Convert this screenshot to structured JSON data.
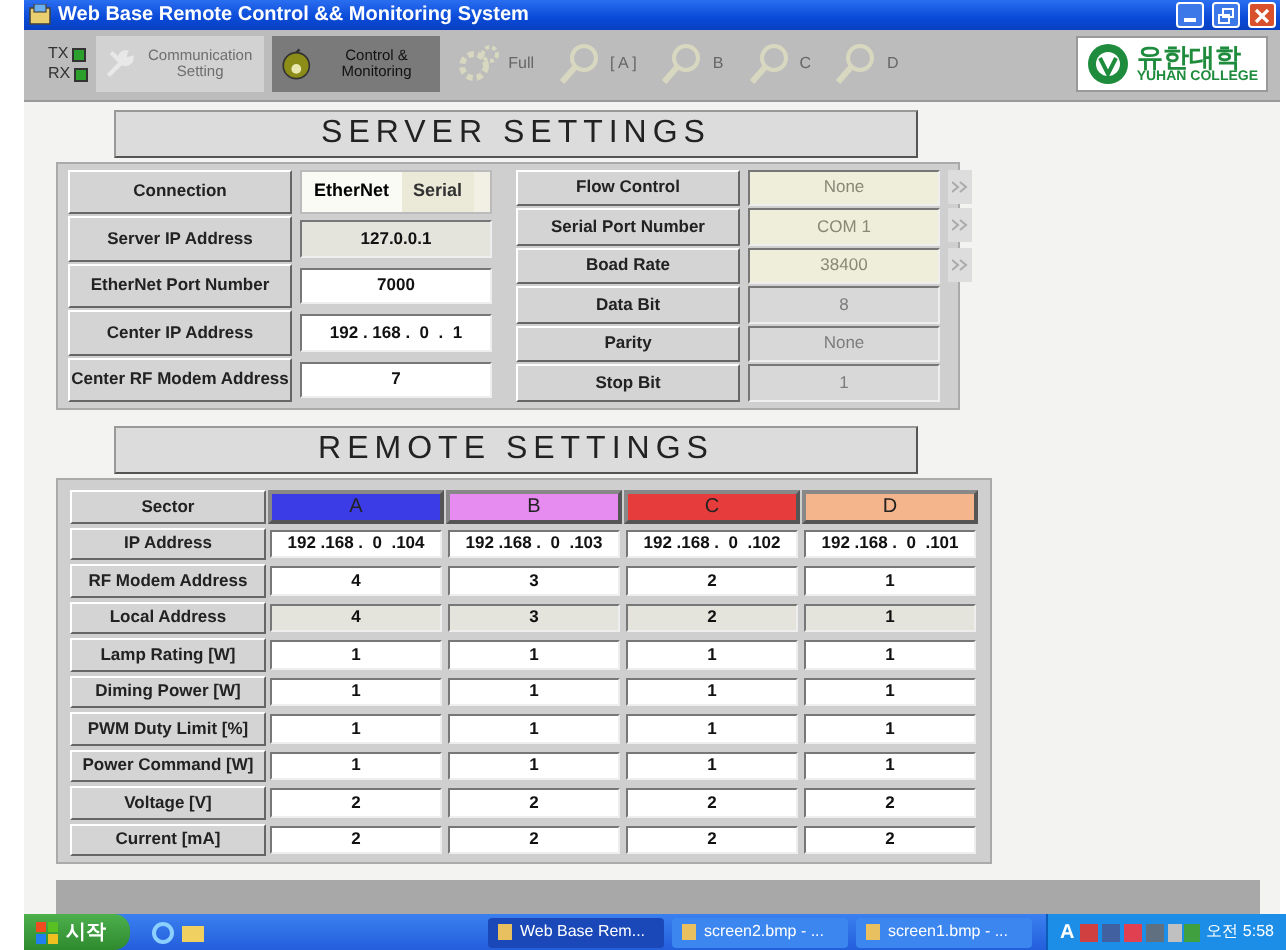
{
  "window": {
    "title": "Web Base Remote Control && Monitoring System"
  },
  "toolbar": {
    "indicators": [
      {
        "label": "TX",
        "on": true
      },
      {
        "label": "RX",
        "on": true
      }
    ],
    "modes": [
      {
        "label": "Communication Setting",
        "kind": "wrench",
        "selected": false
      },
      {
        "label": "Control & Monitoring",
        "kind": "face",
        "selected": true
      }
    ],
    "views": [
      {
        "label": "Full",
        "kind": "gear",
        "disabled": true
      },
      {
        "label": "[ A ]",
        "kind": "magnifier",
        "disabled": true
      },
      {
        "label": "B",
        "kind": "magnifier",
        "disabled": true
      },
      {
        "label": "C",
        "kind": "magnifier",
        "disabled": true
      },
      {
        "label": "D",
        "kind": "magnifier",
        "disabled": true
      }
    ],
    "logo": {
      "name": "유한대학",
      "subtitle": "YUHAN COLLEGE"
    }
  },
  "server_settings": {
    "title": "SERVER SETTINGS",
    "left": [
      {
        "label": "Connection",
        "kind": "toggle",
        "options": [
          {
            "label": "EtherNet",
            "selected": true
          },
          {
            "label": "Serial",
            "selected": false
          }
        ]
      },
      {
        "label": "Server IP Address",
        "kind": "readonly",
        "value": "127.0.0.1"
      },
      {
        "label": "EtherNet Port Number",
        "kind": "input",
        "value": "7000"
      },
      {
        "label": "Center IP Address",
        "kind": "input",
        "value": "192 . 168 .  0  .  1"
      },
      {
        "label": "Center RF Modem Address",
        "kind": "input",
        "value": "7"
      }
    ],
    "right": [
      {
        "label": "Flow Control",
        "kind": "combo",
        "value": "None",
        "disabled": true
      },
      {
        "label": "Serial Port Number",
        "kind": "combo",
        "value": "COM 1",
        "disabled": true
      },
      {
        "label": "Boad Rate",
        "kind": "combo",
        "value": "38400",
        "disabled": true
      },
      {
        "label": "Data Bit",
        "kind": "field",
        "value": "8",
        "disabled": true
      },
      {
        "label": "Parity",
        "kind": "field",
        "value": "None",
        "disabled": true
      },
      {
        "label": "Stop Bit",
        "kind": "field",
        "value": "1",
        "disabled": true
      }
    ]
  },
  "remote_settings": {
    "title": "REMOTE SETTINGS",
    "sector_label": "Sector",
    "sectors": [
      {
        "label": "A",
        "color": "#3c3ce6"
      },
      {
        "label": "B",
        "color": "#e68cf0"
      },
      {
        "label": "C",
        "color": "#e63c3c"
      },
      {
        "label": "D",
        "color": "#f4b48c"
      }
    ],
    "rows": [
      {
        "label": "IP Address",
        "kind": "input",
        "values": [
          "192 .168 .  0  .104",
          "192 .168 .  0  .103",
          "192 .168 .  0  .102",
          "192 .168 .  0  .101"
        ]
      },
      {
        "label": "RF Modem Address",
        "kind": "input",
        "values": [
          "4",
          "3",
          "2",
          "1"
        ]
      },
      {
        "label": "Local Address",
        "kind": "readonly",
        "values": [
          "4",
          "3",
          "2",
          "1"
        ]
      },
      {
        "label": "Lamp Rating [W]",
        "kind": "input",
        "values": [
          "1",
          "1",
          "1",
          "1"
        ]
      },
      {
        "label": "Diming Power [W]",
        "kind": "input",
        "values": [
          "1",
          "1",
          "1",
          "1"
        ]
      },
      {
        "label": "PWM Duty Limit [%]",
        "kind": "input",
        "values": [
          "1",
          "1",
          "1",
          "1"
        ]
      },
      {
        "label": "Power Command [W]",
        "kind": "input",
        "values": [
          "1",
          "1",
          "1",
          "1"
        ]
      },
      {
        "label": "Voltage [V]",
        "kind": "input",
        "values": [
          "2",
          "2",
          "2",
          "2"
        ]
      },
      {
        "label": "Current [mA]",
        "kind": "input",
        "values": [
          "2",
          "2",
          "2",
          "2"
        ]
      }
    ]
  },
  "taskbar": {
    "start": "시작",
    "tasks": [
      {
        "label": "Web Base Rem...",
        "selected": true
      },
      {
        "label": "screen2.bmp - ...",
        "selected": false
      },
      {
        "label": "screen1.bmp - ...",
        "selected": false
      }
    ],
    "tray_text": "A",
    "clock": "오전 5:58"
  }
}
